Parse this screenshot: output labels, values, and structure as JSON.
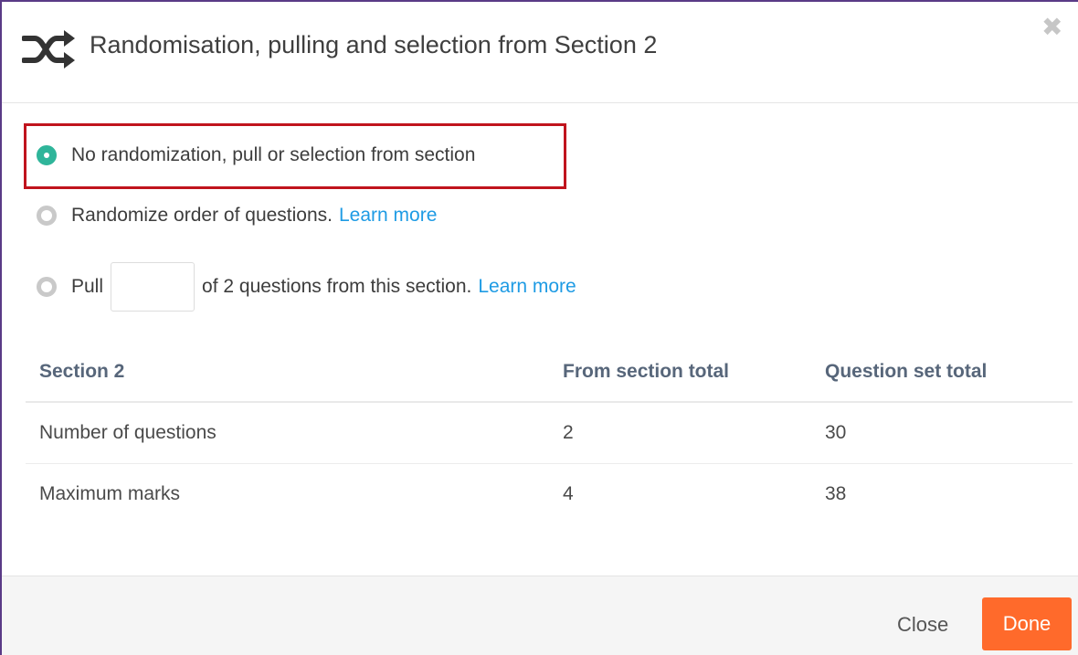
{
  "modal": {
    "title": "Randomisation, pulling and selection from Section 2",
    "close_glyph": "✖"
  },
  "options": {
    "no_random": {
      "label": "No randomization, pull or selection from section",
      "selected": true
    },
    "randomize": {
      "label": "Randomize order of questions.",
      "link": "Learn more",
      "selected": false
    },
    "pull": {
      "prefix": "Pull",
      "input_value": "",
      "suffix": "of 2 questions from this section.",
      "link": "Learn more",
      "selected": false
    }
  },
  "table": {
    "headers": [
      "Section 2",
      "From section total",
      "Question set total"
    ],
    "rows": [
      [
        "Number of questions",
        "2",
        "30"
      ],
      [
        "Maximum marks",
        "4",
        "38"
      ]
    ]
  },
  "footer": {
    "close_label": "Close",
    "done_label": "Done"
  },
  "colors": {
    "accent_radio": "#2fb59a",
    "link": "#1e9be4",
    "done_button": "#ff6a2b",
    "highlight_border": "#c0141d"
  }
}
